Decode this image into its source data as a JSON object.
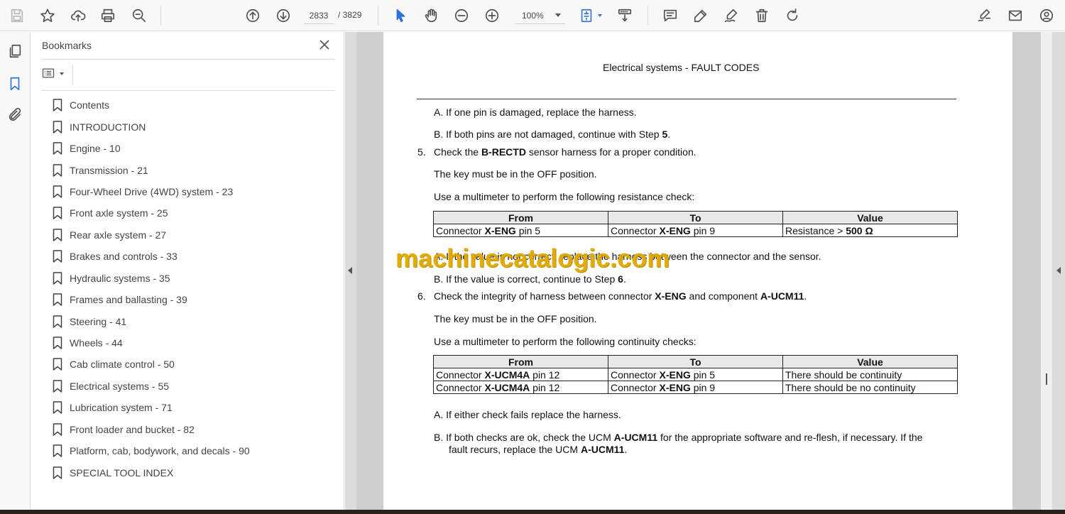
{
  "toolbar": {
    "current_page": "2833",
    "total_pages": "/ 3829",
    "zoom": "100%"
  },
  "bookmarks": {
    "title": "Bookmarks",
    "items": [
      {
        "label": "Contents"
      },
      {
        "label": "INTRODUCTION"
      },
      {
        "label": "Engine - 10"
      },
      {
        "label": "Transmission - 21"
      },
      {
        "label": "Four-Wheel Drive (4WD) system - 23"
      },
      {
        "label": "Front axle system - 25"
      },
      {
        "label": "Rear axle system - 27"
      },
      {
        "label": "Brakes and controls - 33"
      },
      {
        "label": "Hydraulic systems - 35"
      },
      {
        "label": "Frames and ballasting - 39"
      },
      {
        "label": "Steering - 41"
      },
      {
        "label": "Wheels - 44"
      },
      {
        "label": "Cab climate control - 50"
      },
      {
        "label": "Electrical systems - 55"
      },
      {
        "label": "Lubrication system - 71"
      },
      {
        "label": "Front loader and bucket - 82"
      },
      {
        "label": "Platform, cab, bodywork, and decals - 90"
      },
      {
        "label": "SPECIAL TOOL INDEX"
      }
    ]
  },
  "document": {
    "header": "Electrical systems - FAULT CODES",
    "step4_a": "A.  If one pin is damaged, replace the harness.",
    "step4_b_prefix": "B.  If both pins are not damaged, continue with Step ",
    "step4_b_bold": "5",
    "step4_b_suffix": ".",
    "step5_num": "5.",
    "step5_prefix": "Check the ",
    "step5_bold": "B-RECTD",
    "step5_suffix": " sensor harness for a proper condition.",
    "step5_key": "The key must be in the OFF position.",
    "step5_use": "Use a multimeter to perform the following resistance check:",
    "table1": {
      "headers": [
        "From",
        "To",
        "Value"
      ],
      "row": {
        "from_prefix": "Connector ",
        "from_bold": "X-ENG",
        "from_suffix": " pin 5",
        "to_prefix": "Connector ",
        "to_bold": "X-ENG",
        "to_suffix": " pin 9",
        "value_prefix": "Resistance > ",
        "value_bold": "500 Ω"
      }
    },
    "step5_a": "A.  If the value is not correct, replace the harness between the connector and the sensor.",
    "step5_b_prefix": "B.  If the value is correct, continue to Step ",
    "step5_b_bold": "6",
    "step5_b_suffix": ".",
    "step6_num": "6.",
    "step6_prefix": "Check the integrity of harness between connector ",
    "step6_bold1": "X-ENG",
    "step6_mid": " and component ",
    "step6_bold2": "A-UCM11",
    "step6_suffix": ".",
    "step6_key": "The key must be in the OFF position.",
    "step6_use": "Use a multimeter to perform the following continuity checks:",
    "table2": {
      "headers": [
        "From",
        "To",
        "Value"
      ],
      "rows": [
        {
          "from_prefix": "Connector ",
          "from_bold": "X-UCM4A",
          "from_suffix": " pin 12",
          "to_prefix": "Connector ",
          "to_bold": "X-ENG",
          "to_suffix": " pin 5",
          "value": "There should be continuity"
        },
        {
          "from_prefix": "Connector ",
          "from_bold": "X-UCM4A",
          "from_suffix": " pin 12",
          "to_prefix": "Connector ",
          "to_bold": "X-ENG",
          "to_suffix": " pin 9",
          "value": "There should be no continuity"
        }
      ]
    },
    "step6_a": "A.  If either check fails replace the harness.",
    "step6_b_line1_prefix": "B.  If both checks are ok, check the UCM ",
    "step6_b_line1_bold": "A-UCM11",
    "step6_b_line1_suffix": " for the appropriate software and re-flesh, if necessary. If the",
    "step6_b_line2_prefix": "fault recurs, replace the UCM ",
    "step6_b_line2_bold": "A-UCM11",
    "step6_b_line2_suffix": "."
  },
  "watermark": "machinecatalogic.com",
  "colors": {
    "accent": "#2d74d8",
    "watermark": "#e0a800"
  }
}
